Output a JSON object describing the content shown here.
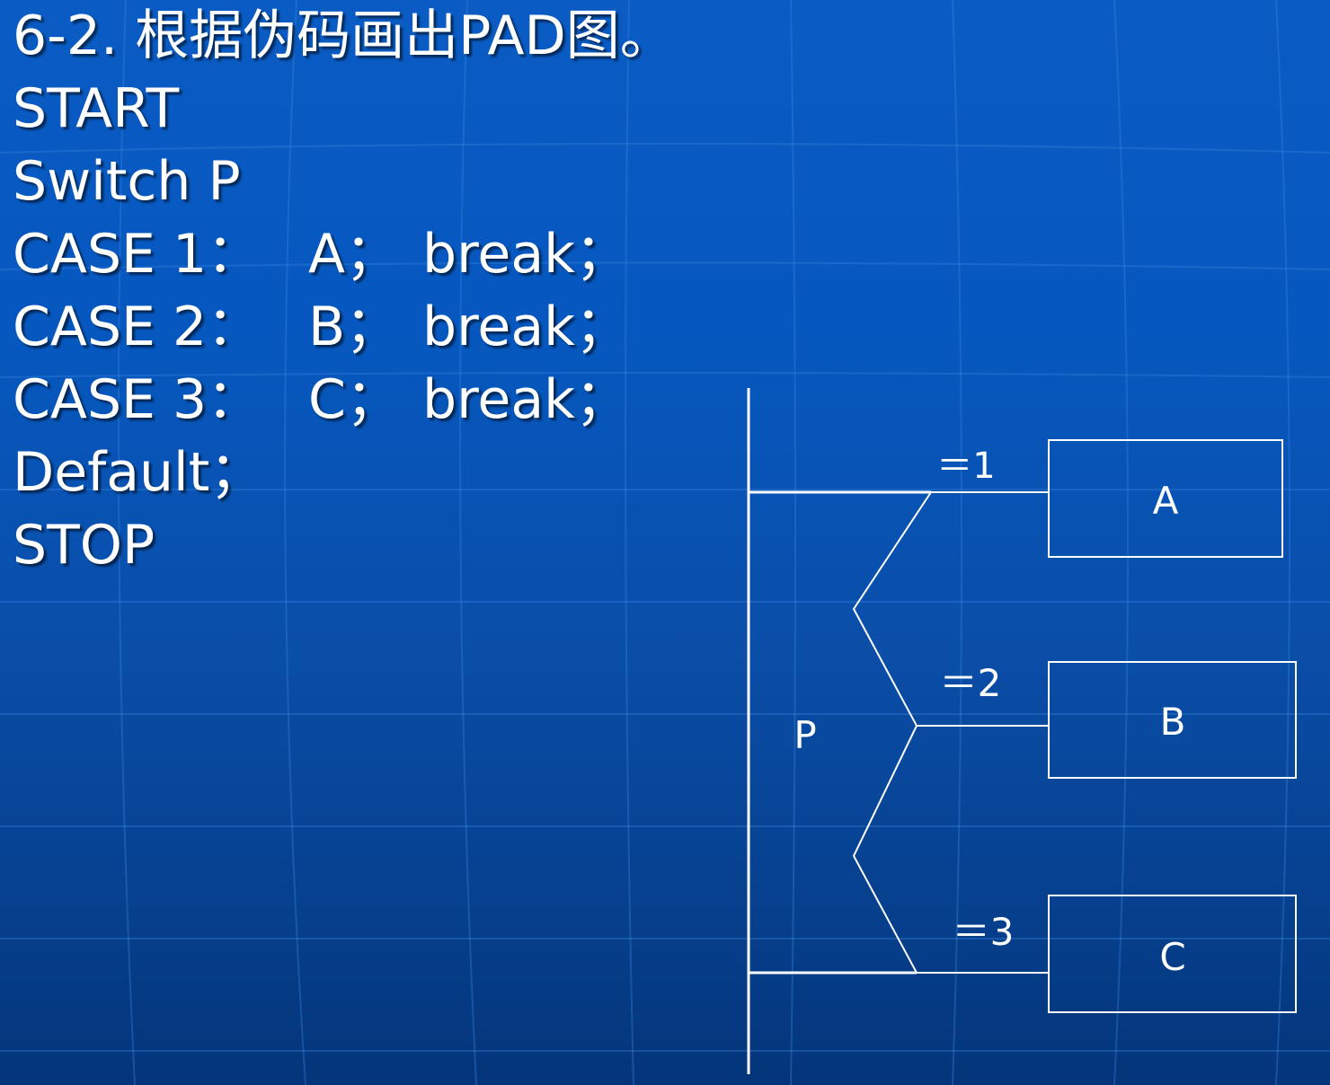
{
  "slide": {
    "title": "6-2. 根据伪码画出PAD图。",
    "lines": {
      "start": "START",
      "switch": "Switch P",
      "case1": {
        "label": "CASE 1：",
        "action": "A；",
        "brk": "break；"
      },
      "case2": {
        "label": "CASE 2：",
        "action": "B；",
        "brk": "break；"
      },
      "case3": {
        "label": "CASE 3：",
        "action": "C；",
        "brk": "break；"
      },
      "default": "Default；",
      "stop": "STOP"
    }
  },
  "diagram": {
    "selector": "P",
    "branch_labels": [
      "＝1",
      "＝2",
      "＝3"
    ],
    "boxes": [
      "A",
      "B",
      "C"
    ],
    "line_color": "#ffffff"
  },
  "colors": {
    "background_top": "#0a5cc4",
    "background_bottom": "#04357a",
    "text": "#ffffff"
  }
}
